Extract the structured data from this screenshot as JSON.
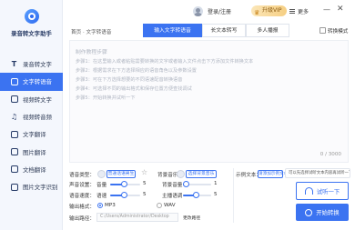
{
  "app": {
    "name": "录音转文字助手"
  },
  "sidebar": {
    "items": [
      {
        "label": "录音转文字",
        "icon": "T"
      },
      {
        "label": "文字转语音",
        "icon": "tts"
      },
      {
        "label": "视频转文字",
        "icon": "video"
      },
      {
        "label": "视频转音频",
        "icon": "audio"
      },
      {
        "label": "文字翻译",
        "icon": "translate"
      },
      {
        "label": "图片翻译",
        "icon": "image"
      },
      {
        "label": "文档翻译",
        "icon": "doc"
      },
      {
        "label": "图片文字识别",
        "icon": "ocr"
      }
    ],
    "active_index": 1
  },
  "topbar": {
    "login_label": "登录/注册",
    "vip_label": "升级VIP",
    "more_label": "更多",
    "min_label": "—",
    "close_label": "✕"
  },
  "breadcrumb": "首页 · 文字转语音",
  "tabs": [
    {
      "label": "输入文字转语音",
      "active": true
    },
    {
      "label": "长文本转写",
      "active": false
    },
    {
      "label": "多人播报",
      "active": false
    }
  ],
  "switch_mode_label": "转换模式",
  "editor": {
    "placeholder_title": "制作教程步骤",
    "steps": [
      "步骤1：在这里输入或者粘贴需要转换的文字或者输入文件点击下方添加文件转换文本",
      "步骤2：根据需求在下方选择相应的语音角色以及参数设置",
      "步骤3：可在下方选择想要的不同语速配音转换语音",
      "步骤4：可选择不同的输出格式和保存位置方便查找调试",
      "步骤5：开始转换并试听一下"
    ],
    "counter": "0 / 3000"
  },
  "settings": {
    "voice_type_label": "语音类型：",
    "voice_type_value": "普通话语男生",
    "bg_music_label": "背景音乐：",
    "bg_music_value": "选择背景音乐",
    "example_label": "示例文本：",
    "example_value": "请添加示例文本",
    "volume_row_label": "声音设置：",
    "volume_label": "音量",
    "volume_value": "5",
    "bg_volume_label": "背景音量",
    "bg_volume_value": "1",
    "speed_row_label": "语音速度：",
    "speed_label": "语速",
    "speed_value": "5",
    "pitch_label": "主播语调",
    "pitch_value": "5",
    "format_label": "输出格式：",
    "format_options": [
      "MP3",
      "WAV"
    ],
    "format_selected": "MP3",
    "path_label": "输出路径：",
    "path_value": "C:/Users/Administrator/Desktop",
    "change_dir_label": "更改路径"
  },
  "actions": {
    "tooltip": "可以先选择试听文本内容再试听一下",
    "trial_label": "试听一下",
    "start_label": "开始转换"
  },
  "colors": {
    "accent": "#3b73f1",
    "sidebar_bg": "#f4f7fd",
    "vip_gold": "#f6cf83"
  }
}
